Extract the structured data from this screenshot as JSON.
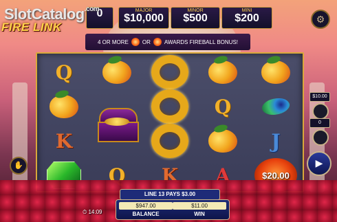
{
  "watermark": {
    "text": "SlotCatalog",
    "suffix": ".com"
  },
  "logo": {
    "text": "FIRE LINK"
  },
  "jackpots": {
    "grand": {
      "label": "",
      "value": "0"
    },
    "major": {
      "label": "MAJOR",
      "value": "$10,000"
    },
    "minor": {
      "label": "MINOR",
      "value": "$500"
    },
    "mini": {
      "label": "MINI",
      "value": "$200"
    }
  },
  "bonus_banner": {
    "prefix": "4 OR MORE",
    "middle": "OR",
    "suffix": "AWARDS FIREBALL BONUS!"
  },
  "reels": [
    [
      "Q",
      "mango",
      "K",
      "gem"
    ],
    [
      "mango",
      "chest",
      "",
      "Q"
    ],
    [
      "ring",
      "ring",
      "ring",
      "K"
    ],
    [
      "mango",
      "Q",
      "mango",
      "A"
    ],
    [
      "mango",
      "feather",
      "J",
      "fireball"
    ]
  ],
  "fireball_value": "$20.00",
  "side_panel": {
    "bet_top": "$10.00",
    "bet_mid": "0"
  },
  "win_line": "LINE 13 PAYS $3.00",
  "balance": {
    "value": "$947.00",
    "label": "BALANCE"
  },
  "win": {
    "value": "$11.00",
    "label": "WIN"
  },
  "clock": "14:09",
  "icons": {
    "settings": "gear-icon",
    "spin": "play-icon",
    "hand": "hand-icon"
  }
}
